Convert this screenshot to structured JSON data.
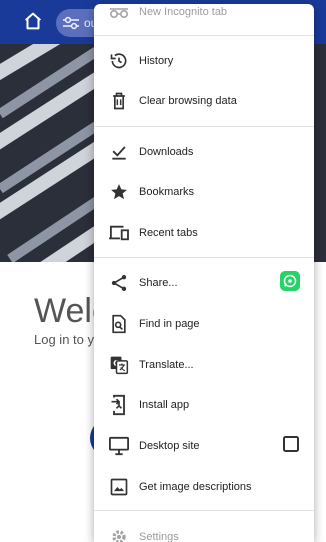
{
  "browser": {
    "url_pill_text": "ou"
  },
  "page": {
    "welcome": "Welc",
    "login_prompt": "Log in to y"
  },
  "menu": {
    "items": [
      {
        "label": "New Incognito tab",
        "icon": "incognito-icon"
      },
      {
        "label": "History",
        "icon": "history-icon"
      },
      {
        "label": "Clear browsing data",
        "icon": "trash-icon"
      },
      {
        "label": "Downloads",
        "icon": "download-icon"
      },
      {
        "label": "Bookmarks",
        "icon": "star-icon"
      },
      {
        "label": "Recent tabs",
        "icon": "devices-icon"
      },
      {
        "label": "Share...",
        "icon": "share-icon",
        "trailing_icon": "whatsapp-icon"
      },
      {
        "label": "Find in page",
        "icon": "find-in-page-icon"
      },
      {
        "label": "Translate...",
        "icon": "translate-icon"
      },
      {
        "label": "Install app",
        "icon": "install-app-icon"
      },
      {
        "label": "Desktop site",
        "icon": "desktop-icon",
        "checked": false
      },
      {
        "label": "Get image descriptions",
        "icon": "image-description-icon"
      },
      {
        "label": "Settings",
        "icon": "gear-icon"
      }
    ]
  },
  "colors": {
    "topbar": "#1a3a9a",
    "whatsapp": "#25d366",
    "icon": "#333333"
  }
}
